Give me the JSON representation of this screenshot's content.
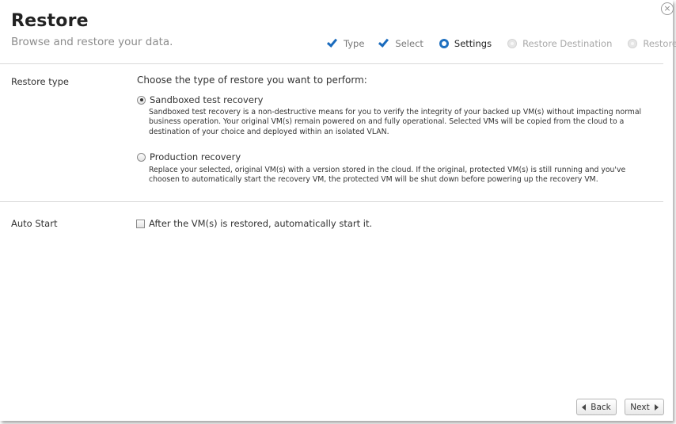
{
  "header": {
    "title": "Restore",
    "subtitle": "Browse and restore your data.",
    "close_symbol": "×"
  },
  "steps": [
    {
      "label": "Type",
      "state": "done",
      "icon": "check-icon"
    },
    {
      "label": "Select",
      "state": "done",
      "icon": "check-icon"
    },
    {
      "label": "Settings",
      "state": "active",
      "icon": "current-step-icon"
    },
    {
      "label": "Restore Destination",
      "state": "pending",
      "icon": "pending-step-icon"
    },
    {
      "label": "Restore",
      "state": "pending",
      "icon": "pending-step-icon"
    }
  ],
  "restore_type": {
    "label": "Restore type",
    "heading": "Choose the type of restore you want to perform:",
    "options": [
      {
        "label": "Sandboxed test recovery",
        "selected": true,
        "description": "Sandboxed test recovery is a non-destructive means for you to verify the integrity of your backed up VM(s) without impacting normal business operation.  Your original VM(s) remain powered on and fully operational.  Selected VMs will be copied from the cloud to a destination of your choice and deployed within an isolated VLAN."
      },
      {
        "label": "Production recovery",
        "selected": false,
        "description": "Replace your selected, original VM(s) with a version stored in the cloud. If the original, protected VM(s) is still running and you've choosen to automatically start the recovery VM, the protected VM will be shut down before powering up the recovery VM."
      }
    ]
  },
  "auto_start": {
    "label": "Auto Start",
    "checkbox_label": "After the VM(s) is restored, automatically start it.",
    "checked": false
  },
  "footer": {
    "back_label": "Back",
    "next_label": "Next"
  },
  "colors": {
    "accent": "#1a6bbd",
    "divider": "#d9d9d9"
  }
}
